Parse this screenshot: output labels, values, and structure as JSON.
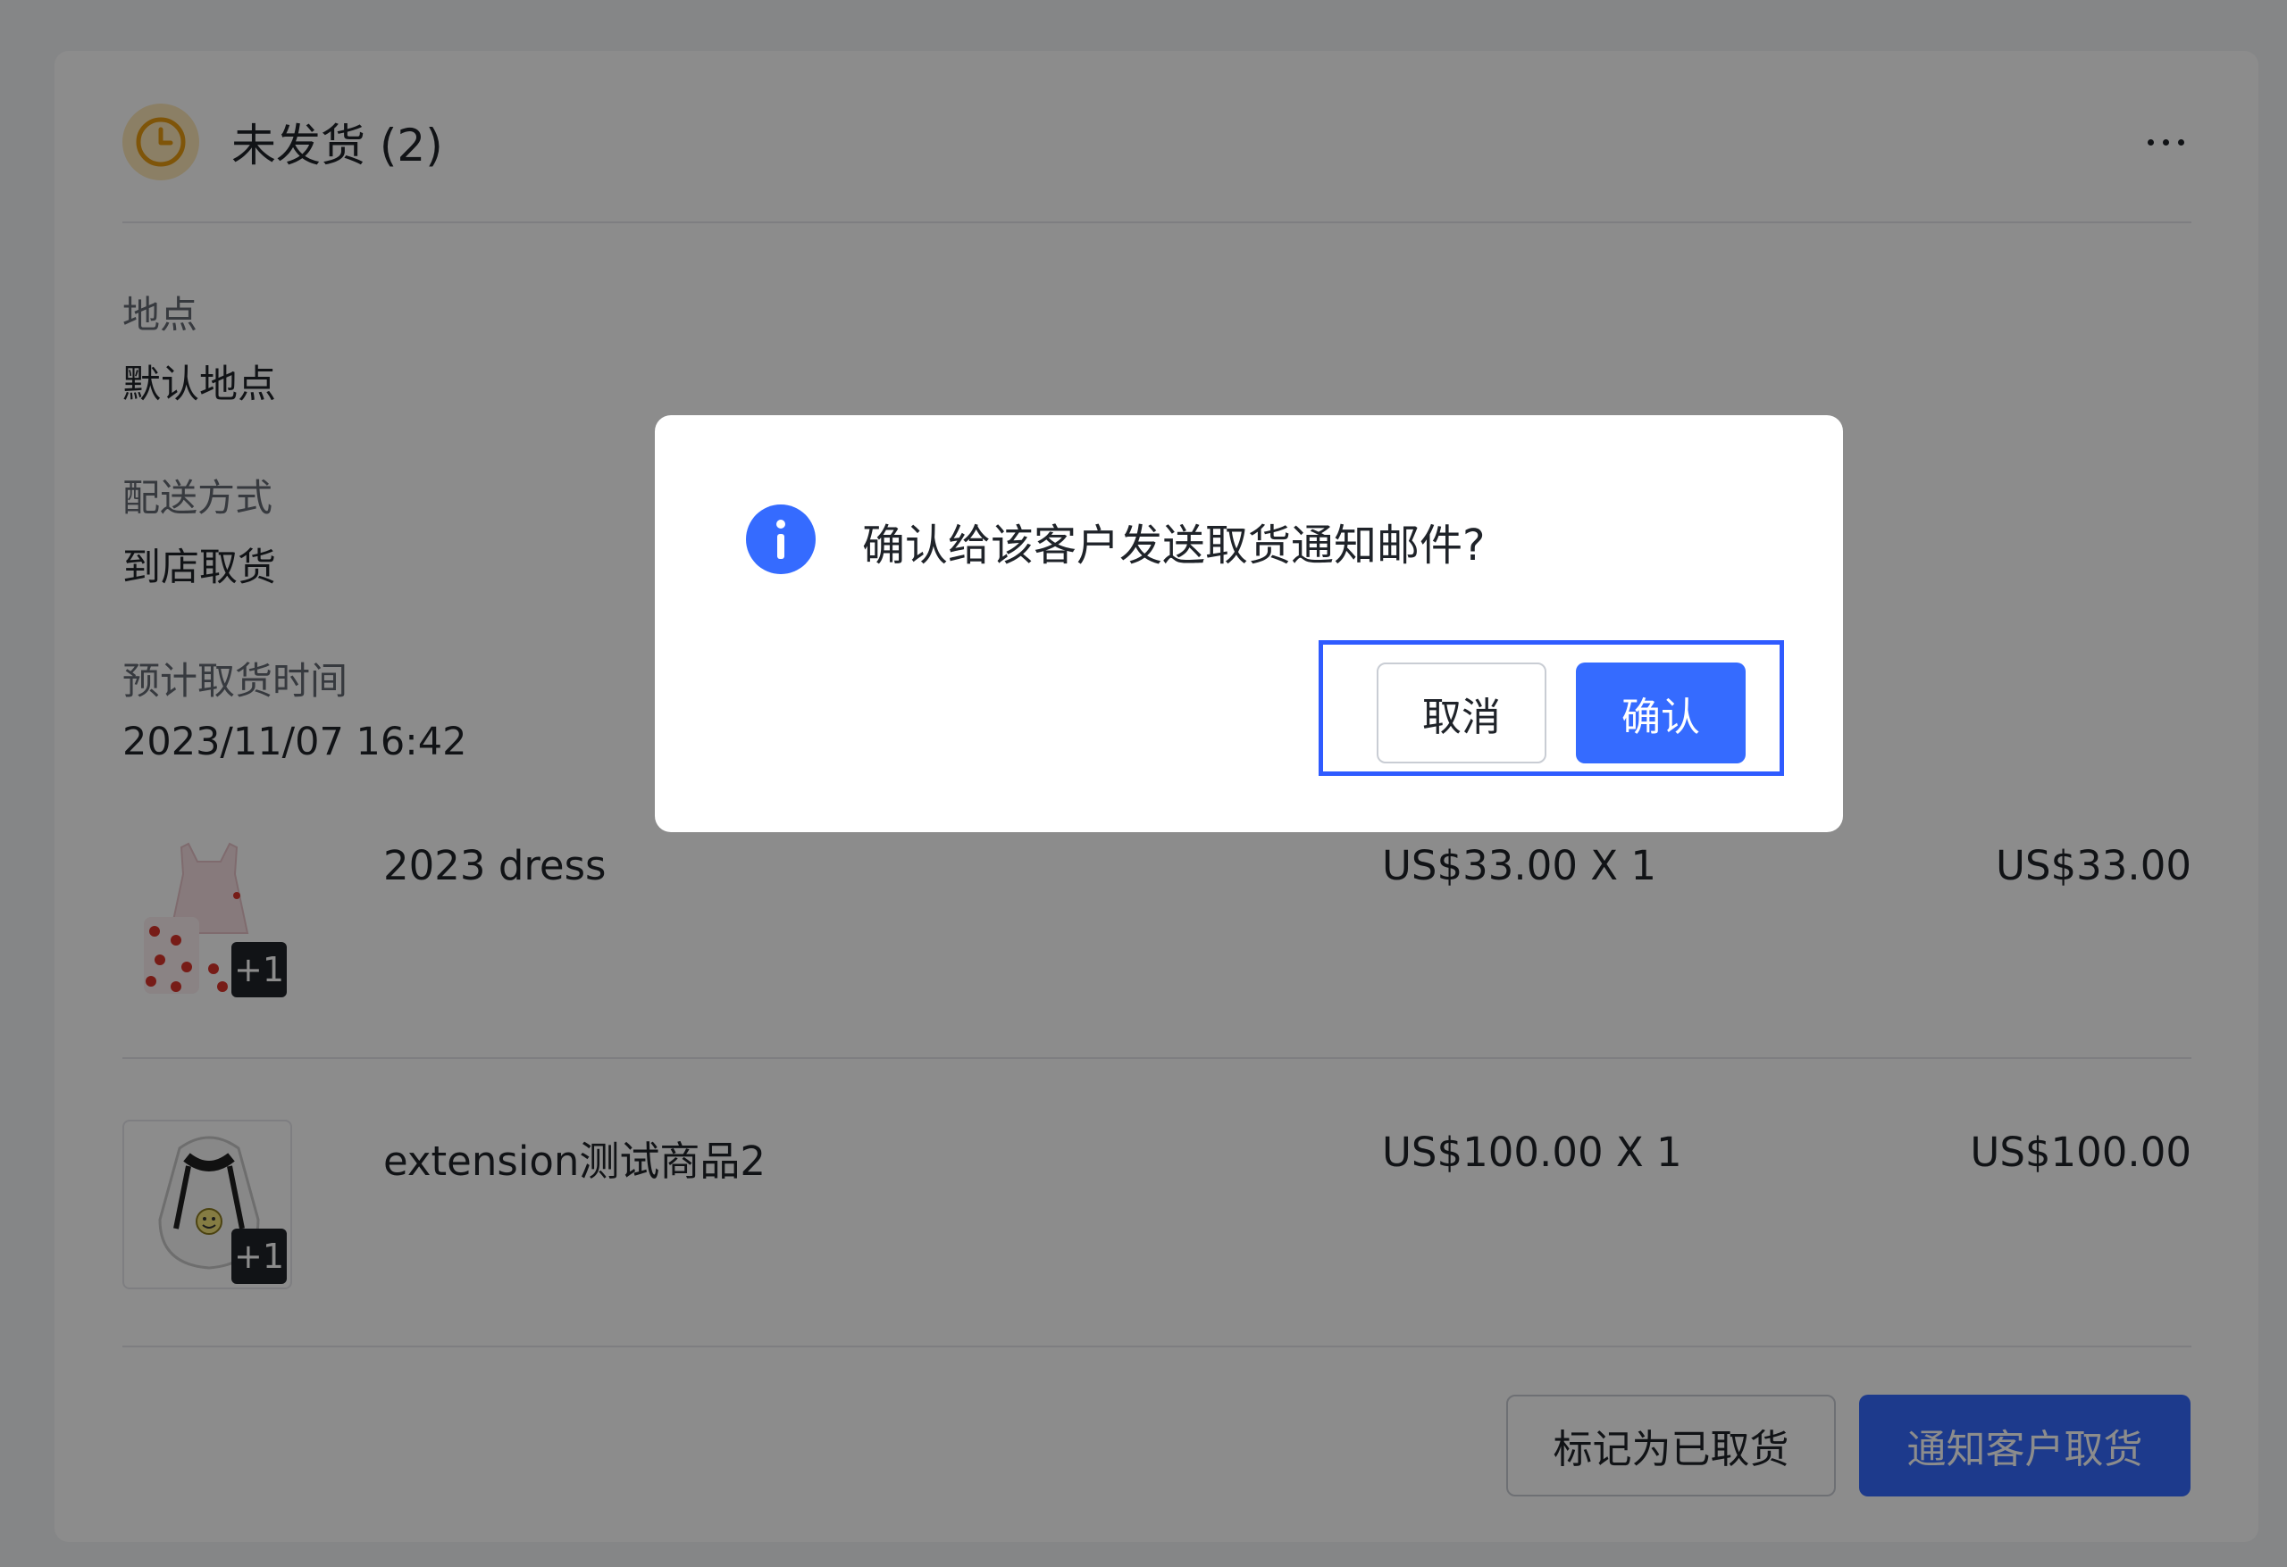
{
  "card": {
    "status_title": "未发货 (2)",
    "fields": [
      {
        "label": "地点",
        "value": "默认地点"
      },
      {
        "label": "配送方式",
        "value": "到店取货"
      },
      {
        "label": "预计取货时间",
        "value": "2023/11/07 16:42"
      }
    ],
    "products": [
      {
        "name": "2023 dress",
        "unit_price": "US$33.00 X 1",
        "total": "US$33.00",
        "extra_count": "+1",
        "thumb_icon": "dress-thumbnail"
      },
      {
        "name": "extension测试商品2",
        "unit_price": "US$100.00 X 1",
        "total": "US$100.00",
        "extra_count": "+1",
        "thumb_icon": "hoodie-thumbnail"
      }
    ],
    "actions": {
      "mark_picked_up": "标记为已取货",
      "notify_customer": "通知客户取货"
    }
  },
  "modal": {
    "title": "确认给该客户发送取货通知邮件?",
    "cancel_label": "取消",
    "confirm_label": "确认"
  },
  "colors": {
    "primary": "#356bff",
    "status_pending": "#f5a623",
    "highlight_border": "#2f5bff"
  }
}
